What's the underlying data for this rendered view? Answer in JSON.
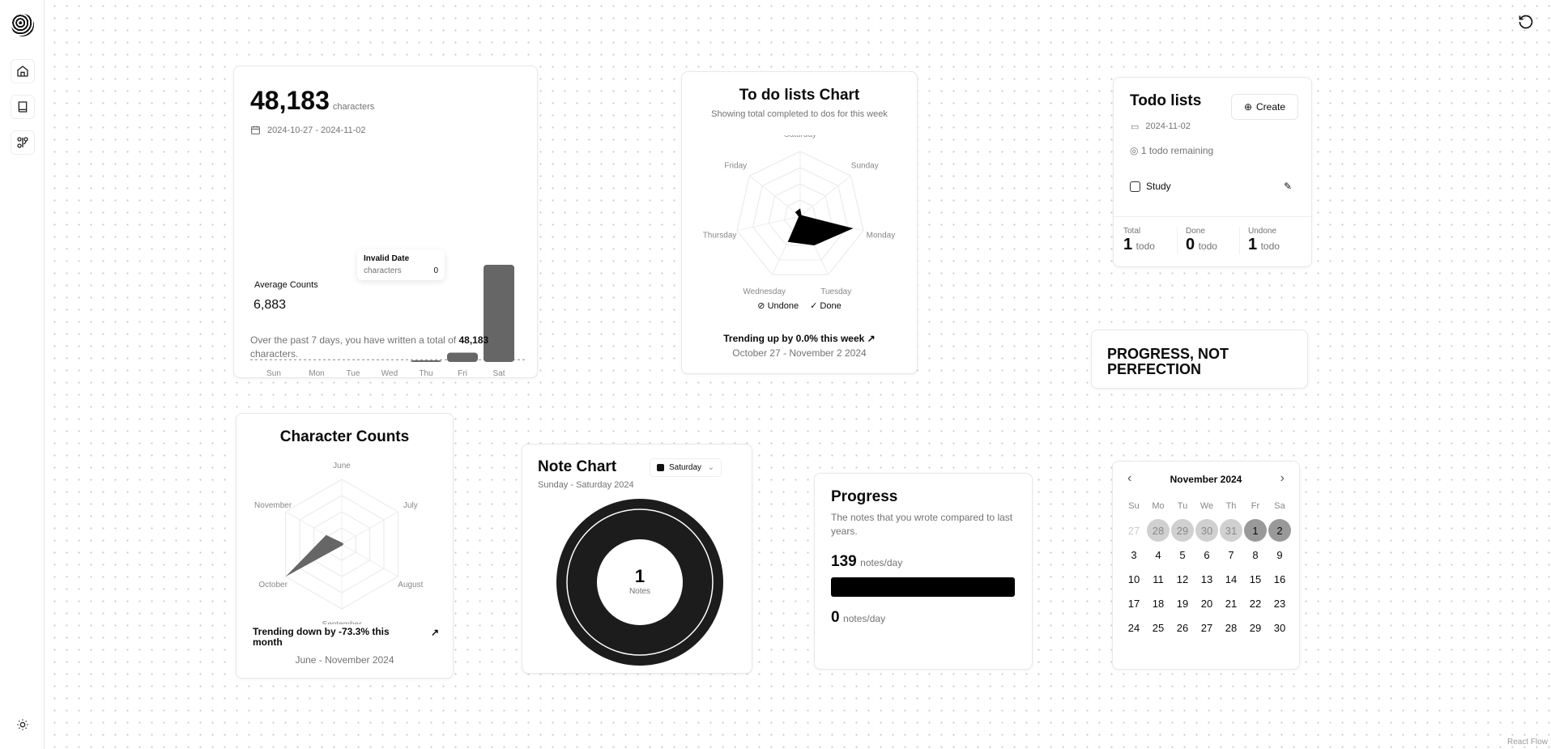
{
  "sidebar": {
    "items": [
      {
        "icon": "logo-icon"
      },
      {
        "icon": "home-icon"
      },
      {
        "icon": "book-icon"
      },
      {
        "icon": "git-compare-icon"
      }
    ],
    "theme_icon": "sun-icon"
  },
  "top_right": {
    "icon": "reset-icon"
  },
  "footer": {
    "attribution": "React Flow"
  },
  "characters_card": {
    "total": "48,183",
    "unit": "characters",
    "date_range": "2024-10-27 - 2024-11-02",
    "avg_label": "Average Counts",
    "avg_value": "6,883",
    "tooltip": {
      "title": "Invalid Date",
      "label": "characters",
      "value": "0"
    },
    "summary_prefix": "Over the past 7 days, you have written a total of",
    "summary_value": "48,183",
    "summary_suffix": "characters."
  },
  "chart_data": [
    {
      "type": "bar",
      "categories": [
        "Sun",
        "Mon",
        "Tue",
        "Wed",
        "Thu",
        "Fri",
        "Sat"
      ],
      "values": [
        0,
        0,
        0,
        0,
        150,
        4200,
        43833
      ],
      "average": 6883,
      "color": "#666666"
    },
    {
      "type": "radar",
      "title": "To do lists Chart",
      "subtitle": "Showing total completed to dos for this week",
      "axes": [
        "Saturday",
        "Friday",
        "Thursday",
        "Wednesday",
        "Tuesday",
        "Monday",
        "Sunday"
      ],
      "series": [
        {
          "name": "Done",
          "values": [
            0.6,
            0.5,
            0,
            2.2,
            2.5,
            4.2,
            0
          ]
        },
        {
          "name": "Undone",
          "values": [
            0,
            0,
            0,
            0,
            0,
            0,
            0
          ]
        }
      ],
      "max": 5,
      "legend": [
        "Undone",
        "Done"
      ],
      "color": "#000000"
    },
    {
      "type": "radar",
      "title": "Character Counts",
      "axes": [
        "June",
        "July",
        "August",
        "September",
        "October",
        "November"
      ],
      "values": [
        0,
        0,
        0,
        0,
        5,
        1.4
      ],
      "max": 5,
      "color": "#666666"
    },
    {
      "type": "pie",
      "title": "Note Chart",
      "subtitle": "Sunday - Saturday 2024",
      "categories": [
        "Saturday"
      ],
      "values": [
        1
      ],
      "center_value": "1",
      "center_label": "Notes",
      "color": "#1c1c1c"
    }
  ],
  "todo_chart": {
    "title": "To do lists Chart",
    "subtitle": "Showing total completed to dos for this week",
    "legend_undone": "Undone",
    "legend_done": "Done",
    "trend": "Trending up by 0.0% this week",
    "range": "October 27 - November 2 2024"
  },
  "todo_lists": {
    "title": "Todo lists",
    "create_label": "Create",
    "date": "2024-11-02",
    "remaining": "1 todo remaining",
    "items": [
      {
        "label": "Study",
        "done": false
      }
    ],
    "stats": [
      {
        "label": "Total",
        "value": "1",
        "unit": "todo"
      },
      {
        "label": "Done",
        "value": "0",
        "unit": "todo"
      },
      {
        "label": "Undone",
        "value": "1",
        "unit": "todo"
      }
    ]
  },
  "quote": {
    "text": "PROGRESS, NOT PERFECTION"
  },
  "char_counts": {
    "title": "Character Counts",
    "trend": "Trending down by -73.3% this month",
    "range": "June - November 2024"
  },
  "note_chart": {
    "title": "Note Chart",
    "subtitle": "Sunday - Saturday 2024",
    "select_value": "Saturday",
    "center_value": "1",
    "center_label": "Notes"
  },
  "progress": {
    "title": "Progress",
    "description": "The notes that you wrote compared to last years.",
    "current_value": "139",
    "current_unit": "notes/day",
    "current_fill": 1.0,
    "previous_value": "0",
    "previous_unit": "notes/day",
    "previous_fill": 0
  },
  "calendar": {
    "month": "November 2024",
    "weekdays": [
      "Su",
      "Mo",
      "Tu",
      "We",
      "Th",
      "Fr",
      "Sa"
    ],
    "weeks": [
      [
        "27",
        "28",
        "29",
        "30",
        "31",
        "1",
        "2"
      ],
      [
        "3",
        "4",
        "5",
        "6",
        "7",
        "8",
        "9"
      ],
      [
        "10",
        "11",
        "12",
        "13",
        "14",
        "15",
        "16"
      ],
      [
        "17",
        "18",
        "19",
        "20",
        "21",
        "22",
        "23"
      ],
      [
        "24",
        "25",
        "26",
        "27",
        "28",
        "29",
        "30"
      ]
    ]
  }
}
